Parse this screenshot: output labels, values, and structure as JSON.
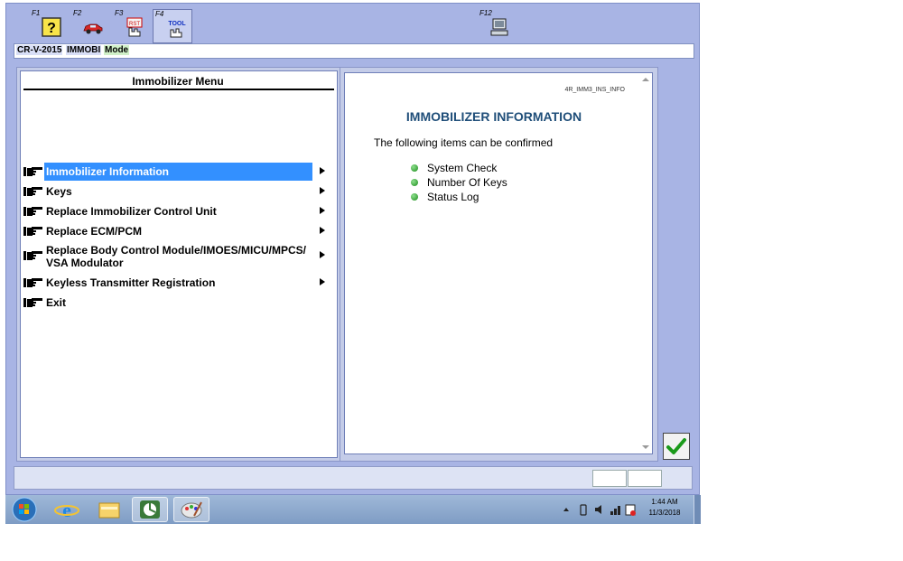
{
  "toolbar": {
    "keys": [
      {
        "label": "F1",
        "icon": "help-icon"
      },
      {
        "label": "F2",
        "icon": "car-icon"
      },
      {
        "label": "F3",
        "icon": "reset-hand-icon"
      },
      {
        "label": "F4",
        "icon": "tool-icon",
        "text": "TOOL"
      },
      {
        "label": "F12",
        "icon": "computer-icon"
      }
    ]
  },
  "mode": {
    "model": "CR-V-2015",
    "system": "IMMOBI",
    "mode_label": "Mode"
  },
  "menu": {
    "title": "Immobilizer Menu",
    "items": [
      {
        "label": "Immobilizer Information",
        "selected": true,
        "has_submenu": true
      },
      {
        "label": "Keys",
        "has_submenu": true
      },
      {
        "label": "Replace Immobilizer Control Unit",
        "has_submenu": true
      },
      {
        "label": "Replace ECM/PCM",
        "has_submenu": true
      },
      {
        "label": "Replace Body Control Module/IMOES/MICU/MPCS/",
        "label2": "VSA Modulator",
        "has_submenu": true
      },
      {
        "label": "Keyless Transmitter Registration",
        "has_submenu": true
      },
      {
        "label": "Exit",
        "has_submenu": false
      }
    ]
  },
  "info": {
    "code": "4R_IMM3_INS_INFO",
    "title": "IMMOBILIZER INFORMATION",
    "intro": "The following items can be confirmed",
    "bullets": [
      "System Check",
      "Number Of Keys",
      "Status Log"
    ]
  },
  "taskbar": {
    "time": "1:44 AM",
    "date": "11/3/2018"
  },
  "colors": {
    "app_bg": "#a8b4e4",
    "selection": "#3390ff",
    "title_blue": "#1f4e79",
    "bullet_green": "#2aa52a"
  }
}
